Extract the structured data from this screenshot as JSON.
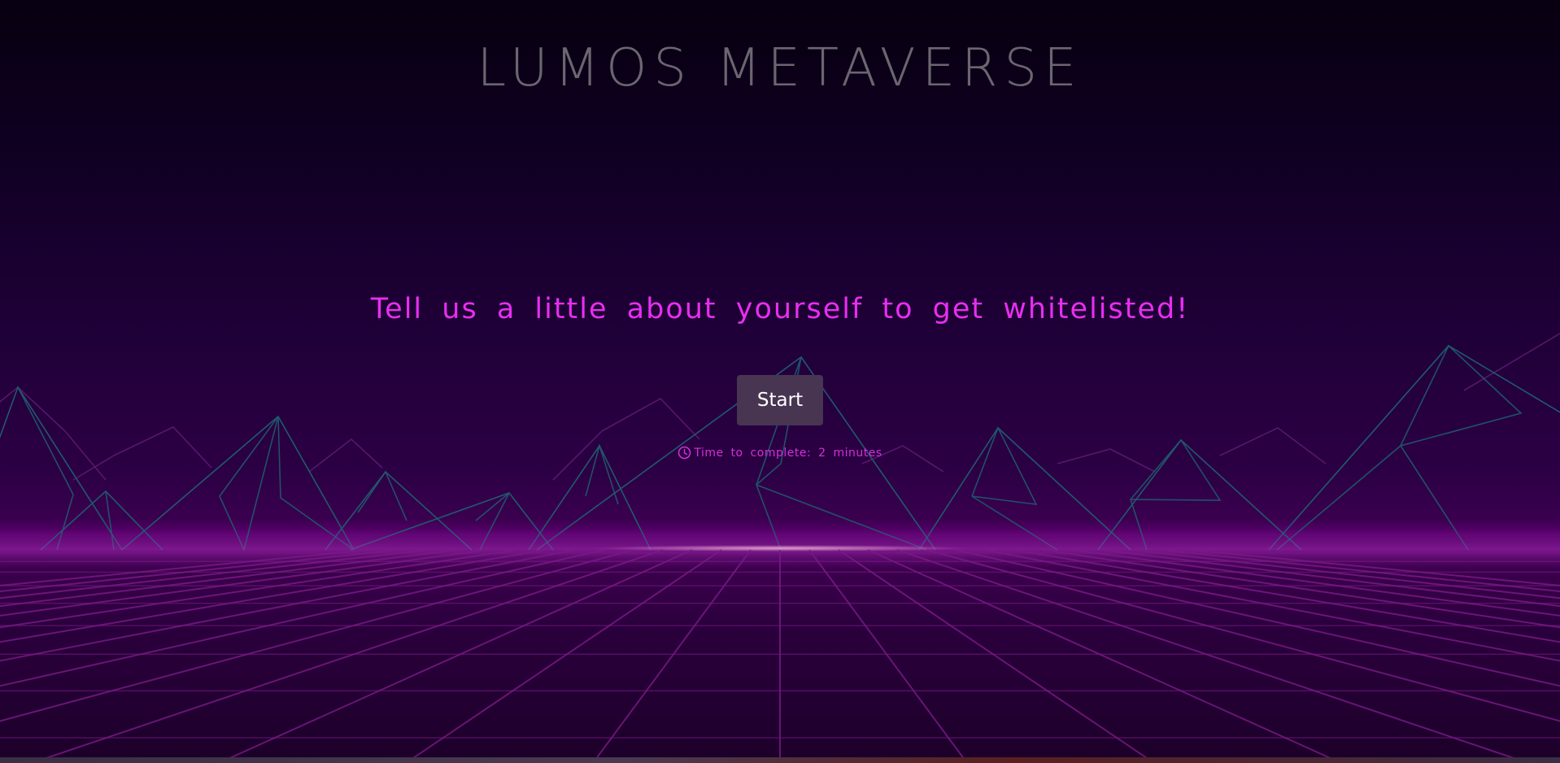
{
  "header": {
    "logo_text": "LUMOS METAVERSE"
  },
  "main": {
    "headline": "Tell us a little about yourself to get whitelisted!",
    "start_button_label": "Start",
    "time_to_complete": "Time to complete: 2 minutes"
  },
  "icons": {
    "time": "clock-icon",
    "logo_mark": "crescent-moon-icon"
  },
  "colors": {
    "headline": "#e82ef0",
    "time_text": "#d42fd9",
    "button_bg": "#473552",
    "button_text": "#ffffff",
    "logo_text": "#6b6670",
    "grid_line": "#7a1a86",
    "mountain_line": "#1f5a6e",
    "horizon_glow": "#a020b0"
  }
}
